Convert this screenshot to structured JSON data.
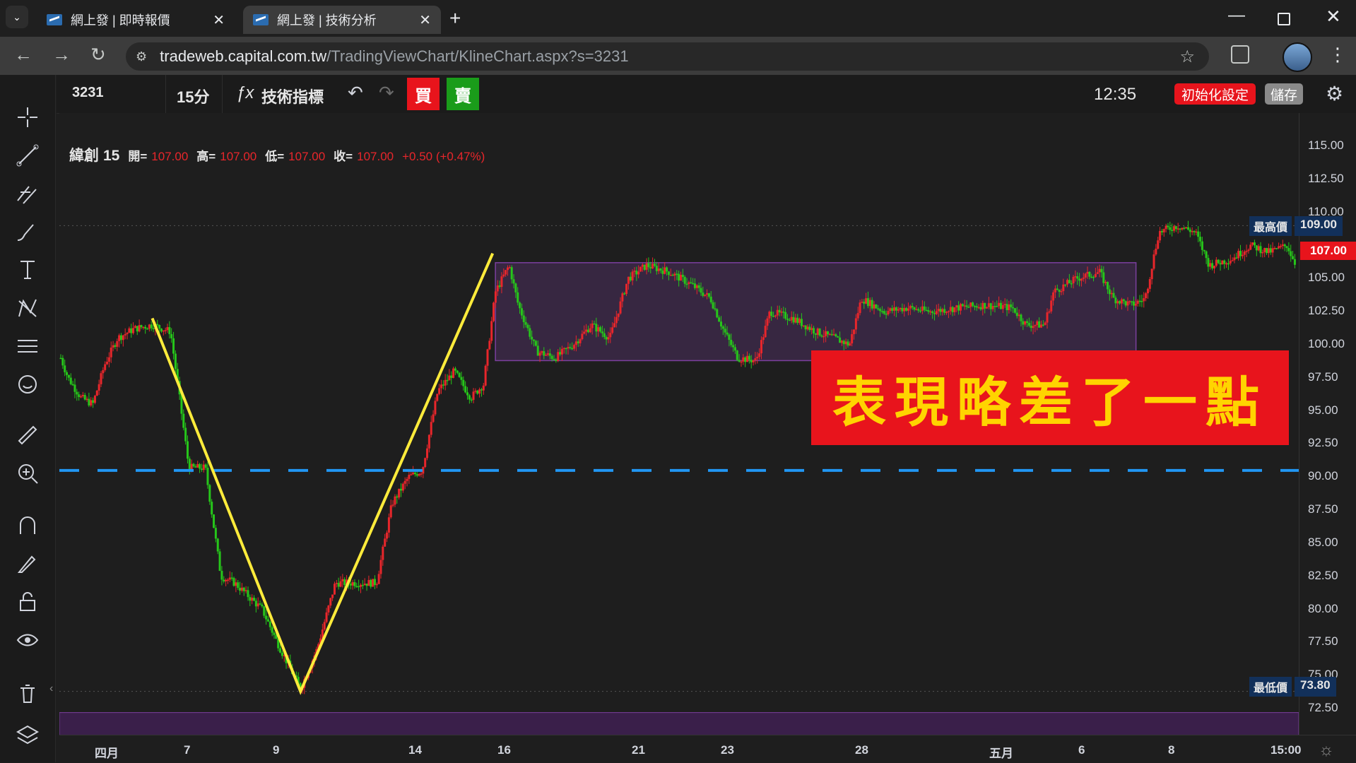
{
  "browser": {
    "tabs": [
      {
        "label": "網上發 | 即時報價",
        "close": "✕"
      },
      {
        "label": "網上發 | 技術分析",
        "close": "✕"
      }
    ],
    "new_tab": "+",
    "url_domain": "tradeweb.capital.com.tw",
    "url_path": "/TradingViewChart/KlineChart.aspx?s=3231"
  },
  "toolbar": {
    "symbol": "3231",
    "interval": "15分",
    "indicators_icon": "ƒx",
    "indicators": "技術指標",
    "buy": "買",
    "sell": "賣",
    "clock": "12:35",
    "reset": "初始化設定",
    "save": "儲存"
  },
  "legend": {
    "name": "緯創",
    "interval": "15",
    "open_label": "開=",
    "open": "107.00",
    "high_label": "高=",
    "high": "107.00",
    "low_label": "低=",
    "low": "107.00",
    "close_label": "收=",
    "close": "107.00",
    "change": "+0.50 (+0.47%)"
  },
  "annotation": "表現略差了一點",
  "price_axis": {
    "ticks": [
      "115.00",
      "112.50",
      "110.00",
      "105.00",
      "102.50",
      "100.00",
      "97.50",
      "95.00",
      "92.50",
      "90.00",
      "87.50",
      "85.00",
      "82.50",
      "80.00",
      "77.50",
      "75.00",
      "72.50"
    ],
    "high_tag": "最高價",
    "high_value": "109.00",
    "last_value": "107.00",
    "low_tag": "最低價",
    "low_value": "73.80"
  },
  "time_axis": [
    "四月",
    "7",
    "9",
    "14",
    "16",
    "21",
    "23",
    "28",
    "五月",
    "6",
    "8",
    "15:00"
  ],
  "colors": {
    "up": "#e8262b",
    "down": "#26c61a",
    "trendline": "#ffeb3b",
    "hline": "#2196f3",
    "range_box": "#7b3f9e",
    "annotation_bg": "#e8141c",
    "annotation_text": "#ffd400"
  },
  "chart_data": {
    "type": "candlestick",
    "symbol": "緯創",
    "y_range": [
      72.5,
      115
    ],
    "last_price": 107.0,
    "session_high": 109.0,
    "session_low": 73.8,
    "horizontal_line": 90.5,
    "range_box": {
      "top": 106.2,
      "bottom": 98.8
    },
    "path": [
      [
        0,
        99.0
      ],
      [
        8,
        97.5
      ],
      [
        22,
        96.0
      ],
      [
        35,
        95.5
      ],
      [
        48,
        98.5
      ],
      [
        62,
        100.5
      ],
      [
        80,
        101.2
      ],
      [
        100,
        101.5
      ],
      [
        120,
        101.0
      ],
      [
        140,
        90.7
      ],
      [
        158,
        90.7
      ],
      [
        175,
        82.5
      ],
      [
        190,
        82.0
      ],
      [
        205,
        81.0
      ],
      [
        220,
        80.0
      ],
      [
        240,
        77.0
      ],
      [
        262,
        74.0
      ],
      [
        280,
        77.0
      ],
      [
        300,
        82.0
      ],
      [
        320,
        82.0
      ],
      [
        345,
        82.0
      ],
      [
        362,
        88.0
      ],
      [
        380,
        90.0
      ],
      [
        395,
        90.5
      ],
      [
        412,
        96.5
      ],
      [
        430,
        98.0
      ],
      [
        448,
        96.0
      ],
      [
        462,
        97.0
      ],
      [
        475,
        104.0
      ],
      [
        490,
        106.0
      ],
      [
        500,
        103.0
      ],
      [
        520,
        99.5
      ],
      [
        540,
        99.0
      ],
      [
        560,
        100.0
      ],
      [
        580,
        101.5
      ],
      [
        600,
        100.5
      ],
      [
        620,
        105.0
      ],
      [
        640,
        106.0
      ],
      [
        665,
        105.5
      ],
      [
        690,
        104.5
      ],
      [
        710,
        103.5
      ],
      [
        725,
        101.0
      ],
      [
        740,
        99.0
      ],
      [
        760,
        98.8
      ],
      [
        775,
        102.5
      ],
      [
        800,
        102.0
      ],
      [
        825,
        101.0
      ],
      [
        845,
        100.5
      ],
      [
        862,
        100.0
      ],
      [
        875,
        103.5
      ],
      [
        900,
        102.5
      ],
      [
        925,
        102.8
      ],
      [
        950,
        102.5
      ],
      [
        980,
        102.8
      ],
      [
        1010,
        103.0
      ],
      [
        1040,
        102.8
      ],
      [
        1055,
        101.5
      ],
      [
        1075,
        101.5
      ],
      [
        1085,
        104.0
      ],
      [
        1110,
        105.0
      ],
      [
        1135,
        105.5
      ],
      [
        1150,
        103.5
      ],
      [
        1170,
        103.0
      ],
      [
        1185,
        103.5
      ],
      [
        1200,
        108.5
      ],
      [
        1220,
        109.0
      ],
      [
        1240,
        108.5
      ],
      [
        1255,
        106.0
      ],
      [
        1280,
        106.5
      ],
      [
        1300,
        107.5
      ],
      [
        1320,
        107.0
      ],
      [
        1340,
        107.5
      ],
      [
        1350,
        106.0
      ]
    ]
  }
}
